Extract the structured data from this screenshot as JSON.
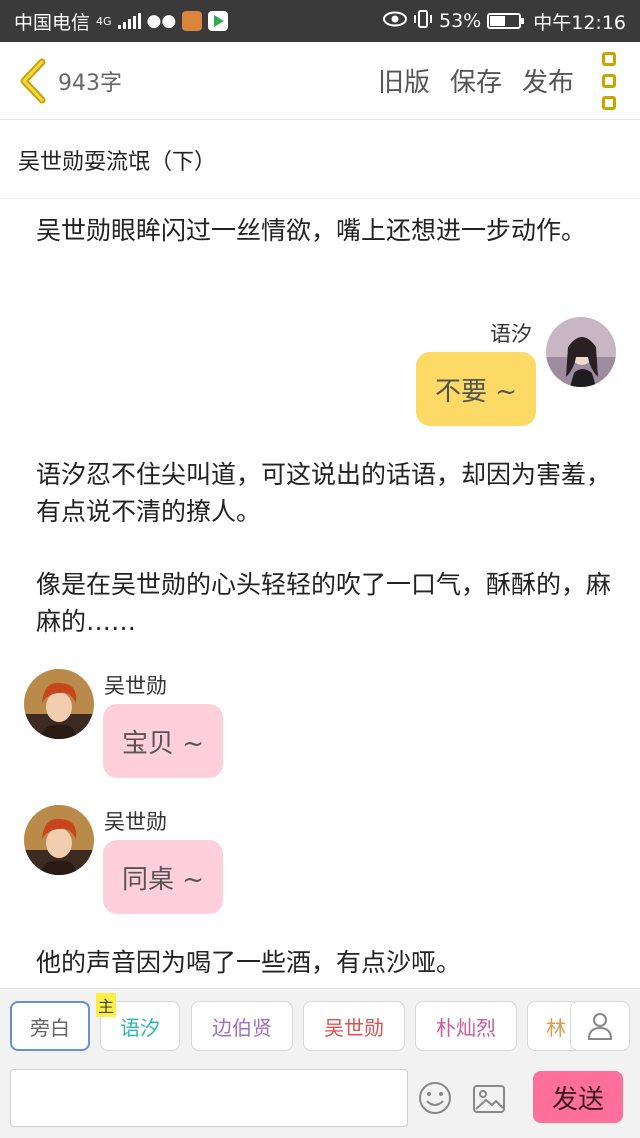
{
  "status_bar": {
    "carrier": "中国电信",
    "network": "4G",
    "battery_percent": "53%",
    "time": "中午12:16",
    "battery_level": 0.53,
    "colors": {
      "background": "#3a3a3a"
    }
  },
  "header": {
    "word_count": "943字",
    "actions": [
      "旧版",
      "保存",
      "发布"
    ],
    "back_icon": "chevron-left-icon",
    "menu_icon": "more-vertical-icon",
    "accent_color": "#c9a400"
  },
  "chapter": {
    "title": "吴世勋耍流氓（下）"
  },
  "story": {
    "narration_1": "吴世勋眼眸闪过一丝情欲，嘴上还想进一步动作。",
    "dialog_1": {
      "speaker": "语汐",
      "text": "不要 ~"
    },
    "narration_2": "语汐忍不住尖叫道，可这说出的话语，却因为害羞，有点说不清的撩人。",
    "narration_3": "像是在吴世勋的心头轻轻的吹了一口气，酥酥的，麻麻的……",
    "dialog_2": {
      "speaker": "吴世勋",
      "text": "宝贝 ~"
    },
    "dialog_3": {
      "speaker": "吴世勋",
      "text": "同桌 ~"
    },
    "narration_4": "他的声音因为喝了一些酒，有点沙哑。"
  },
  "role_bar": {
    "main_badge": "主",
    "roles": [
      {
        "label": "旁白",
        "color": "#666666"
      },
      {
        "label": "语汐",
        "color": "#2cb9b0"
      },
      {
        "label": "边伯贤",
        "color": "#a070c8"
      },
      {
        "label": "吴世勋",
        "color": "#e05050"
      },
      {
        "label": "朴灿烈",
        "color": "#c85aa0"
      },
      {
        "label": "林",
        "color": "#e09a50"
      }
    ]
  },
  "composer": {
    "input_value": "",
    "send_label": "发送",
    "send_color": "#ff6f9b"
  }
}
